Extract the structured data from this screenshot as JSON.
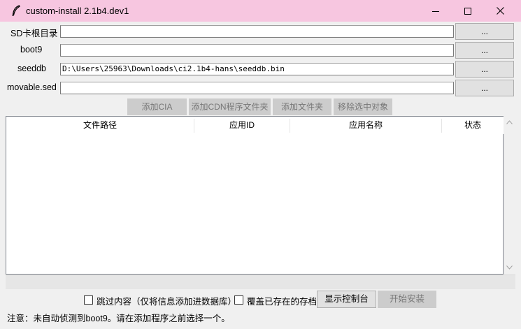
{
  "window": {
    "title": "custom-install 2.1b4.dev1",
    "icon": "feather-icon",
    "controls": [
      "minimize-icon",
      "maximize-icon",
      "close-icon"
    ]
  },
  "fields": [
    {
      "label": "SD卡根目录",
      "value": "",
      "button": "..."
    },
    {
      "label": "boot9",
      "value": "",
      "button": "..."
    },
    {
      "label": "seeddb",
      "value": "D:\\Users\\25963\\Downloads\\ci2.1b4-hans\\seeddb.bin",
      "button": "..."
    },
    {
      "label": "movable.sed",
      "value": "",
      "button": "..."
    }
  ],
  "actions": {
    "add_cia": "添加CIA",
    "add_cdn": "添加CDN程序文件夹",
    "add_folder": "添加文件夹",
    "remove_selected": "移除选中对象"
  },
  "table": {
    "columns": [
      "文件路径",
      "应用ID",
      "应用名称",
      "状态"
    ],
    "rows": []
  },
  "options": {
    "skip_contents": "跳过内容（仅将信息添加进数据库）",
    "overwrite_saves": "覆盖已存在的存档",
    "skip_contents_checked": false,
    "overwrite_saves_checked": false
  },
  "buttons": {
    "show_console": "显示控制台",
    "start_install": "开始安装"
  },
  "status": "注意：未自动侦测到boot9。请在添加程序之前选择一个。",
  "colors": {
    "titlebar": "#f7c6e0",
    "disabled_button": "#cccccc",
    "disabled_text": "#777777"
  }
}
